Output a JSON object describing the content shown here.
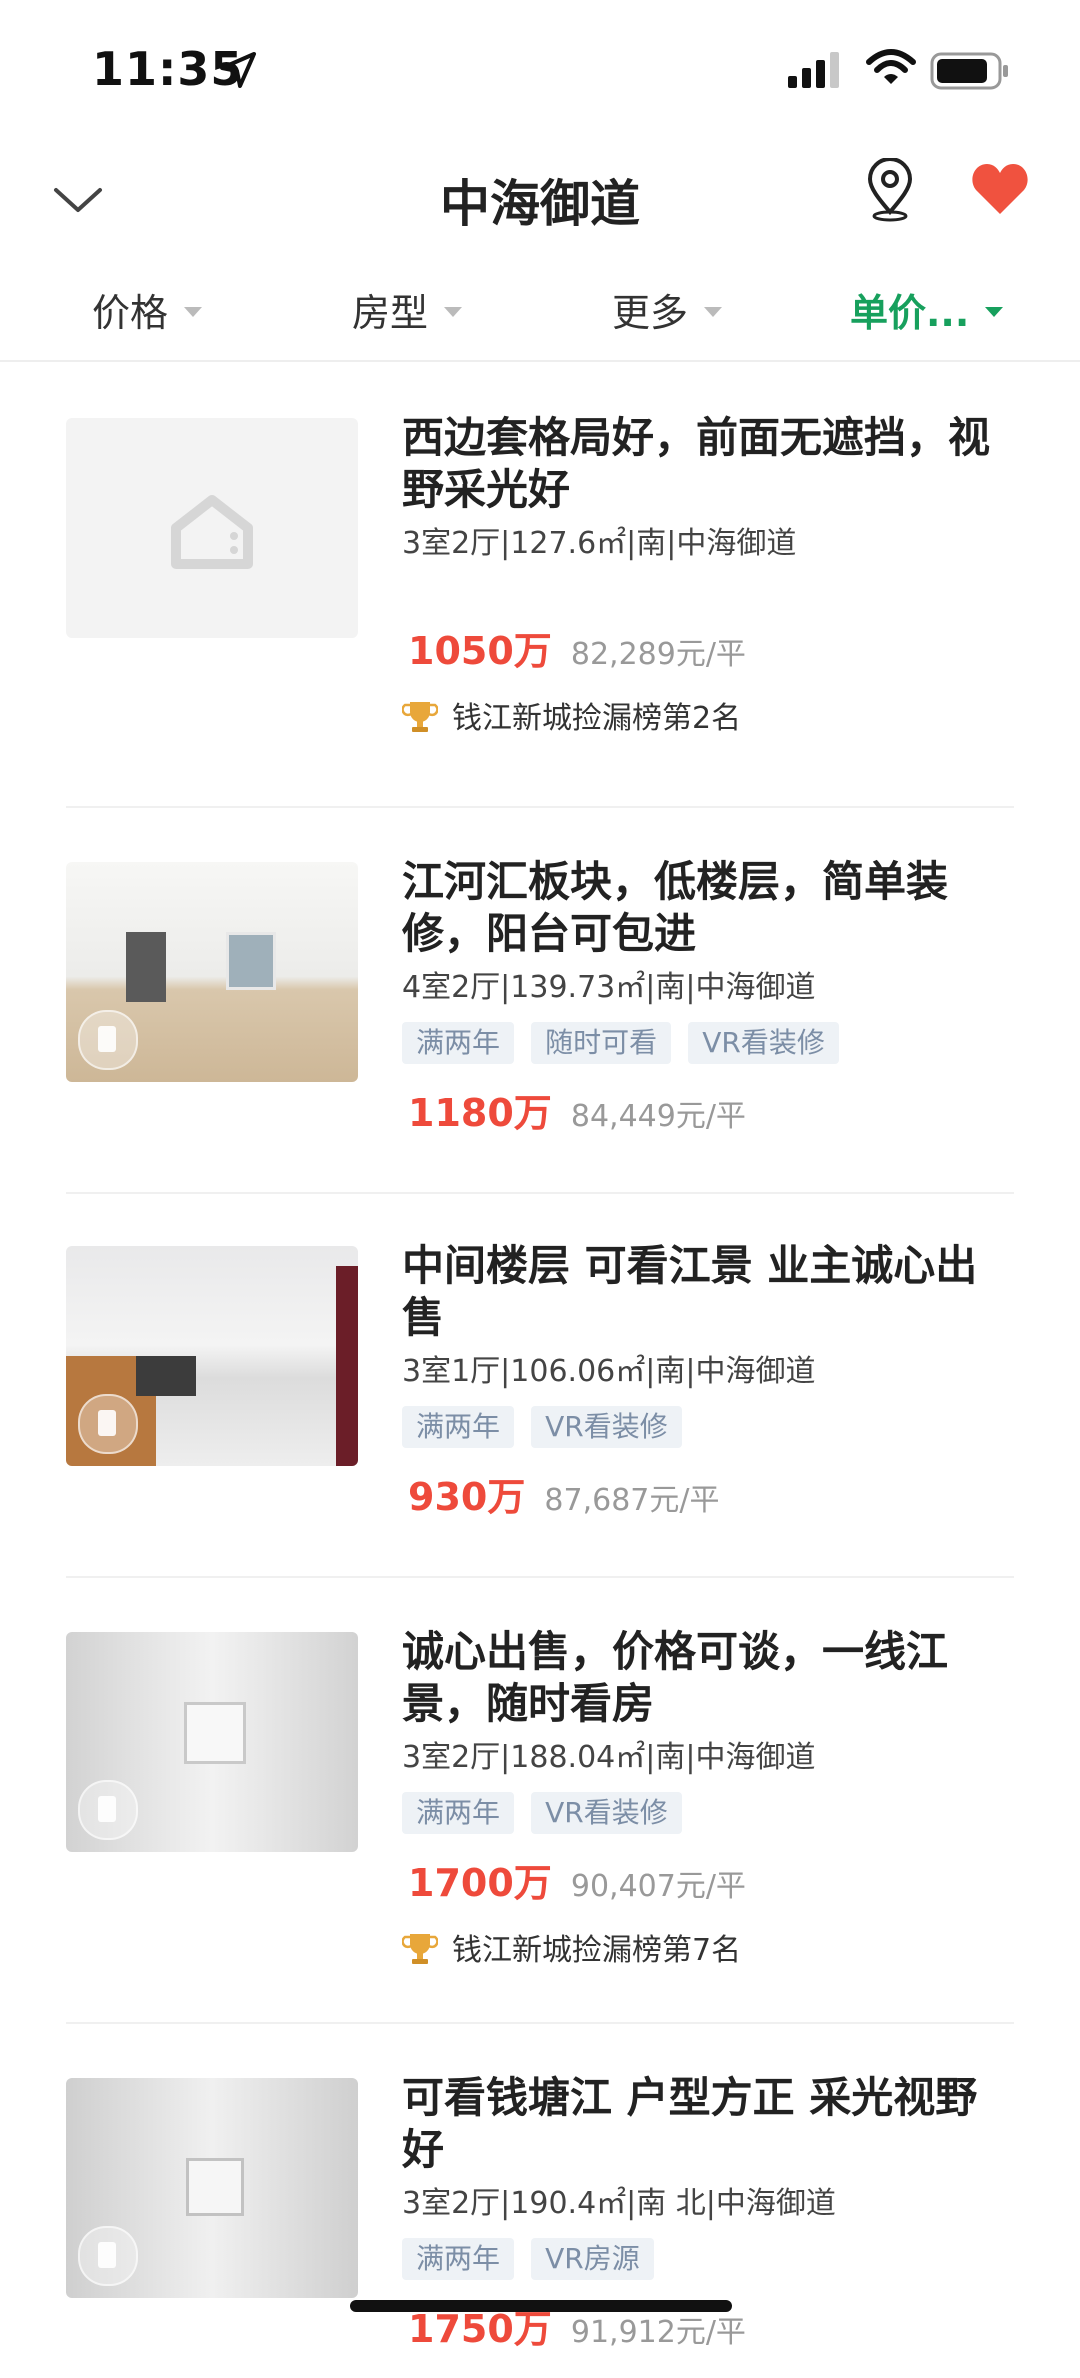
{
  "status_bar": {
    "time": "11:35"
  },
  "nav": {
    "title": "中海御道"
  },
  "filters": [
    {
      "label": "价格",
      "active": false
    },
    {
      "label": "房型",
      "active": false
    },
    {
      "label": "更多",
      "active": false
    },
    {
      "label": "单价...",
      "active": true
    }
  ],
  "listings": [
    {
      "title": "西边套格局好，前面无遮挡，视野采光好",
      "meta": "3室2厅|127.6㎡|南|中海御道",
      "tags": [],
      "price": "1050万",
      "unit_price": "82,289元/平",
      "rank": "钱江新城捡漏榜第2名"
    },
    {
      "title": "江河汇板块，低楼层，简单装修，阳台可包进",
      "meta": "4室2厅|139.73㎡|南|中海御道",
      "tags": [
        "满两年",
        "随时可看",
        "VR看装修"
      ],
      "price": "1180万",
      "unit_price": "84,449元/平"
    },
    {
      "title": "中间楼层  可看江景  业主诚心出售",
      "meta": "3室1厅|106.06㎡|南|中海御道",
      "tags": [
        "满两年",
        "VR看装修"
      ],
      "price": "930万",
      "unit_price": "87,687元/平"
    },
    {
      "title": "诚心出售，价格可谈，一线江景，随时看房",
      "meta": "3室2厅|188.04㎡|南|中海御道",
      "tags": [
        "满两年",
        "VR看装修"
      ],
      "price": "1700万",
      "unit_price": "90,407元/平",
      "rank": "钱江新城捡漏榜第7名"
    },
    {
      "title": "可看钱塘江  户型方正  采光视野好",
      "meta": "3室2厅|190.4㎡|南  北|中海御道",
      "tags": [
        "满两年",
        "VR房源"
      ],
      "price": "1750万",
      "unit_price": "91,912元/平"
    }
  ],
  "colors": {
    "accent": "#17a05d",
    "price": "#ee4a3b",
    "heart": "#f0523f"
  }
}
